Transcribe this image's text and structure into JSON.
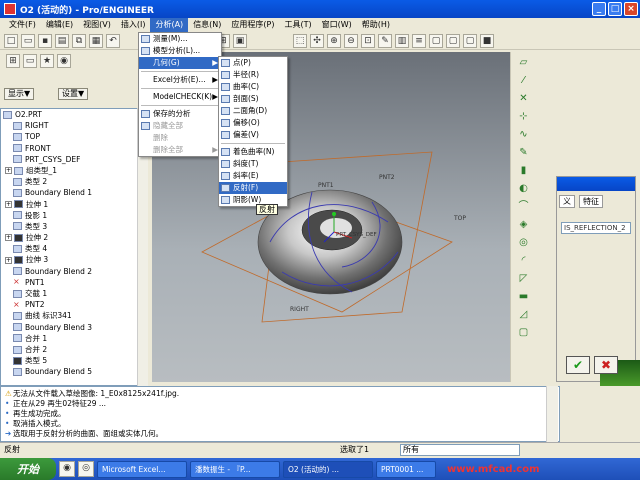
{
  "window": {
    "title": "O2 (活动的) - Pro/ENGINEER"
  },
  "menubar": [
    {
      "label": "文件(F)"
    },
    {
      "label": "编辑(E)"
    },
    {
      "label": "视图(V)"
    },
    {
      "label": "插入(I)"
    },
    {
      "label": "分析(A)"
    },
    {
      "label": "信息(N)"
    },
    {
      "label": "应用程序(P)"
    },
    {
      "label": "工具(T)"
    },
    {
      "label": "窗口(W)"
    },
    {
      "label": "帮助(H)"
    }
  ],
  "active_menu": "分析(A)",
  "analysis_menu": [
    {
      "label": "测量(M)..."
    },
    {
      "label": "模型分析(L)..."
    },
    {
      "label": "几何(G)",
      "arrow": "▶"
    },
    {
      "label": "Excel分析(E)...",
      "arrow": "▶"
    },
    {
      "label": "ModelCHECK(K)",
      "arrow": "▶"
    },
    {
      "label": "保存的分析"
    },
    {
      "label": "隐藏全部"
    },
    {
      "label": "删除"
    },
    {
      "label": "删除全部",
      "arrow": "▶"
    }
  ],
  "geometry_submenu": [
    {
      "label": "点(P)"
    },
    {
      "label": "半径(R)"
    },
    {
      "label": "曲率(C)"
    },
    {
      "label": "剖面(S)"
    },
    {
      "label": "二面角(D)"
    },
    {
      "label": "偏移(O)"
    },
    {
      "label": "偏差(V)"
    },
    {
      "label": "着色曲率(N)"
    },
    {
      "label": "斜度(T)"
    },
    {
      "label": "斜率(E)"
    },
    {
      "label": "反射(F)"
    },
    {
      "label": "阴影(W)"
    }
  ],
  "tooltip": "反射",
  "left_panel": {
    "display_btn": "显示▼",
    "settings_btn": "设置▼"
  },
  "model_tree": [
    {
      "label": "O2.PRT"
    },
    {
      "label": "RIGHT"
    },
    {
      "label": "TOP"
    },
    {
      "label": "FRONT"
    },
    {
      "label": "PRT_CSYS_DEF"
    },
    {
      "label": "组类型_1"
    },
    {
      "label": "类型 2"
    },
    {
      "label": "Boundary Blend 1"
    },
    {
      "label": "拉伸 1"
    },
    {
      "label": "投影 1"
    },
    {
      "label": "类型 3"
    },
    {
      "label": "拉伸 2"
    },
    {
      "label": "类型 4"
    },
    {
      "label": "拉伸 3"
    },
    {
      "label": "Boundary Blend 2"
    },
    {
      "label": "PNT1"
    },
    {
      "label": "交截 1"
    },
    {
      "label": "PNT2"
    },
    {
      "label": "曲线 标识341"
    },
    {
      "label": "Boundary Blend 3"
    },
    {
      "label": "合并 1"
    },
    {
      "label": "合并 2"
    },
    {
      "label": "类型 5"
    },
    {
      "label": "Boundary Blend 5"
    }
  ],
  "viewport_labels": {
    "pnt1": "PNT1",
    "pnt2": "PNT2",
    "csys": "PRT_CSYS_DEF",
    "top": "TOP",
    "right": "RIGHT"
  },
  "right_panel": {
    "tab1": "义",
    "tab2": "特征",
    "field": "IS_REFLECTION_2"
  },
  "messages": [
    {
      "icon": "warn",
      "text": "无法从文件载入草绘图像: 1_E0x8125x241f.jpg."
    },
    {
      "icon": "info",
      "text": "正在从29 再生02特征29 ..."
    },
    {
      "icon": "info",
      "text": "再生成功完成。"
    },
    {
      "icon": "info",
      "text": "取消插入模式。"
    },
    {
      "icon": "info",
      "text": "选取用于反射分析的曲面、面组或实体几何。"
    }
  ],
  "statusbar": {
    "left": "反射",
    "selected": "选取了1",
    "filter": "所有"
  },
  "taskbar": {
    "start": "开始",
    "tasks": [
      {
        "label": "Microsoft Excel..."
      },
      {
        "label": "潘数振生 - 『P..."
      },
      {
        "label": "O2 (活动的) ..."
      },
      {
        "label": "PRT0001 ..."
      }
    ],
    "watermark": "www.mfcad.com"
  }
}
